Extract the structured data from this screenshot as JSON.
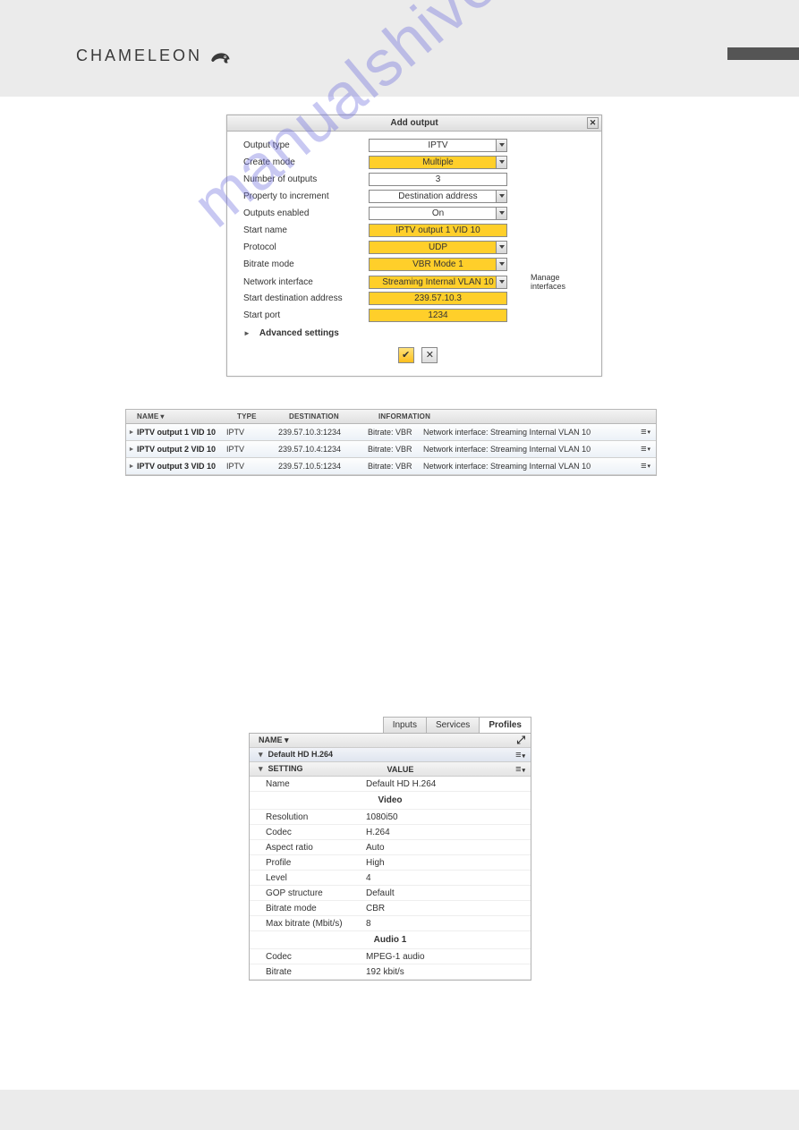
{
  "brand": "CHAMELEON",
  "watermark": "manualshive.com",
  "dialog": {
    "title": "Add output",
    "manage_label": "Manage interfaces",
    "advanced_label": "Advanced settings",
    "fields": {
      "output_type": {
        "label": "Output type",
        "value": "IPTV",
        "yellow": false,
        "dropdown": true
      },
      "create_mode": {
        "label": "Create mode",
        "value": "Multiple",
        "yellow": true,
        "dropdown": true
      },
      "num_outputs": {
        "label": "Number of outputs",
        "value": "3",
        "yellow": false,
        "dropdown": false
      },
      "prop_increment": {
        "label": "Property to increment",
        "value": "Destination address",
        "yellow": false,
        "dropdown": true
      },
      "enabled": {
        "label": "Outputs enabled",
        "value": "On",
        "yellow": false,
        "dropdown": true
      },
      "start_name": {
        "label": "Start name",
        "value": "IPTV output 1 VID 10",
        "yellow": true,
        "dropdown": false
      },
      "protocol": {
        "label": "Protocol",
        "value": "UDP",
        "yellow": true,
        "dropdown": true
      },
      "bitrate_mode": {
        "label": "Bitrate mode",
        "value": "VBR Mode 1",
        "yellow": true,
        "dropdown": true
      },
      "net_if": {
        "label": "Network interface",
        "value": "Streaming Internal VLAN 10",
        "yellow": true,
        "dropdown": true
      },
      "start_addr": {
        "label": "Start destination address",
        "value": "239.57.10.3",
        "yellow": true,
        "dropdown": false
      },
      "start_port": {
        "label": "Start port",
        "value": "1234",
        "yellow": true,
        "dropdown": false
      }
    }
  },
  "outputs_table": {
    "headers": {
      "name": "NAME",
      "type": "TYPE",
      "dest": "DESTINATION",
      "info": "INFORMATION"
    },
    "rows": [
      {
        "name": "IPTV output 1 VID 10",
        "type": "IPTV",
        "dest": "239.57.10.3:1234",
        "bitrate": "Bitrate: VBR",
        "ni": "Network interface: Streaming Internal VLAN 10"
      },
      {
        "name": "IPTV output 2 VID 10",
        "type": "IPTV",
        "dest": "239.57.10.4:1234",
        "bitrate": "Bitrate: VBR",
        "ni": "Network interface: Streaming Internal VLAN 10"
      },
      {
        "name": "IPTV output 3 VID 10",
        "type": "IPTV",
        "dest": "239.57.10.5:1234",
        "bitrate": "Bitrate: VBR",
        "ni": "Network interface: Streaming Internal VLAN 10"
      }
    ]
  },
  "profiles": {
    "tabs": {
      "inputs": "Inputs",
      "services": "Services",
      "profiles": "Profiles"
    },
    "name_header": "NAME",
    "section_name": "Default HD H.264",
    "settings_header": {
      "setting": "SETTING",
      "value": "VALUE"
    },
    "video_label": "Video",
    "audio_label": "Audio 1",
    "rows": [
      {
        "k": "Name",
        "v": "Default HD H.264"
      },
      {
        "k": "Resolution",
        "v": "1080i50"
      },
      {
        "k": "Codec",
        "v": "H.264"
      },
      {
        "k": "Aspect ratio",
        "v": "Auto"
      },
      {
        "k": "Profile",
        "v": "High"
      },
      {
        "k": "Level",
        "v": "4"
      },
      {
        "k": "GOP structure",
        "v": "Default"
      },
      {
        "k": "Bitrate mode",
        "v": "CBR"
      },
      {
        "k": "Max bitrate (Mbit/s)",
        "v": "8"
      },
      {
        "k": "Codec",
        "v": "MPEG-1 audio"
      },
      {
        "k": "Bitrate",
        "v": "192 kbit/s"
      }
    ]
  }
}
